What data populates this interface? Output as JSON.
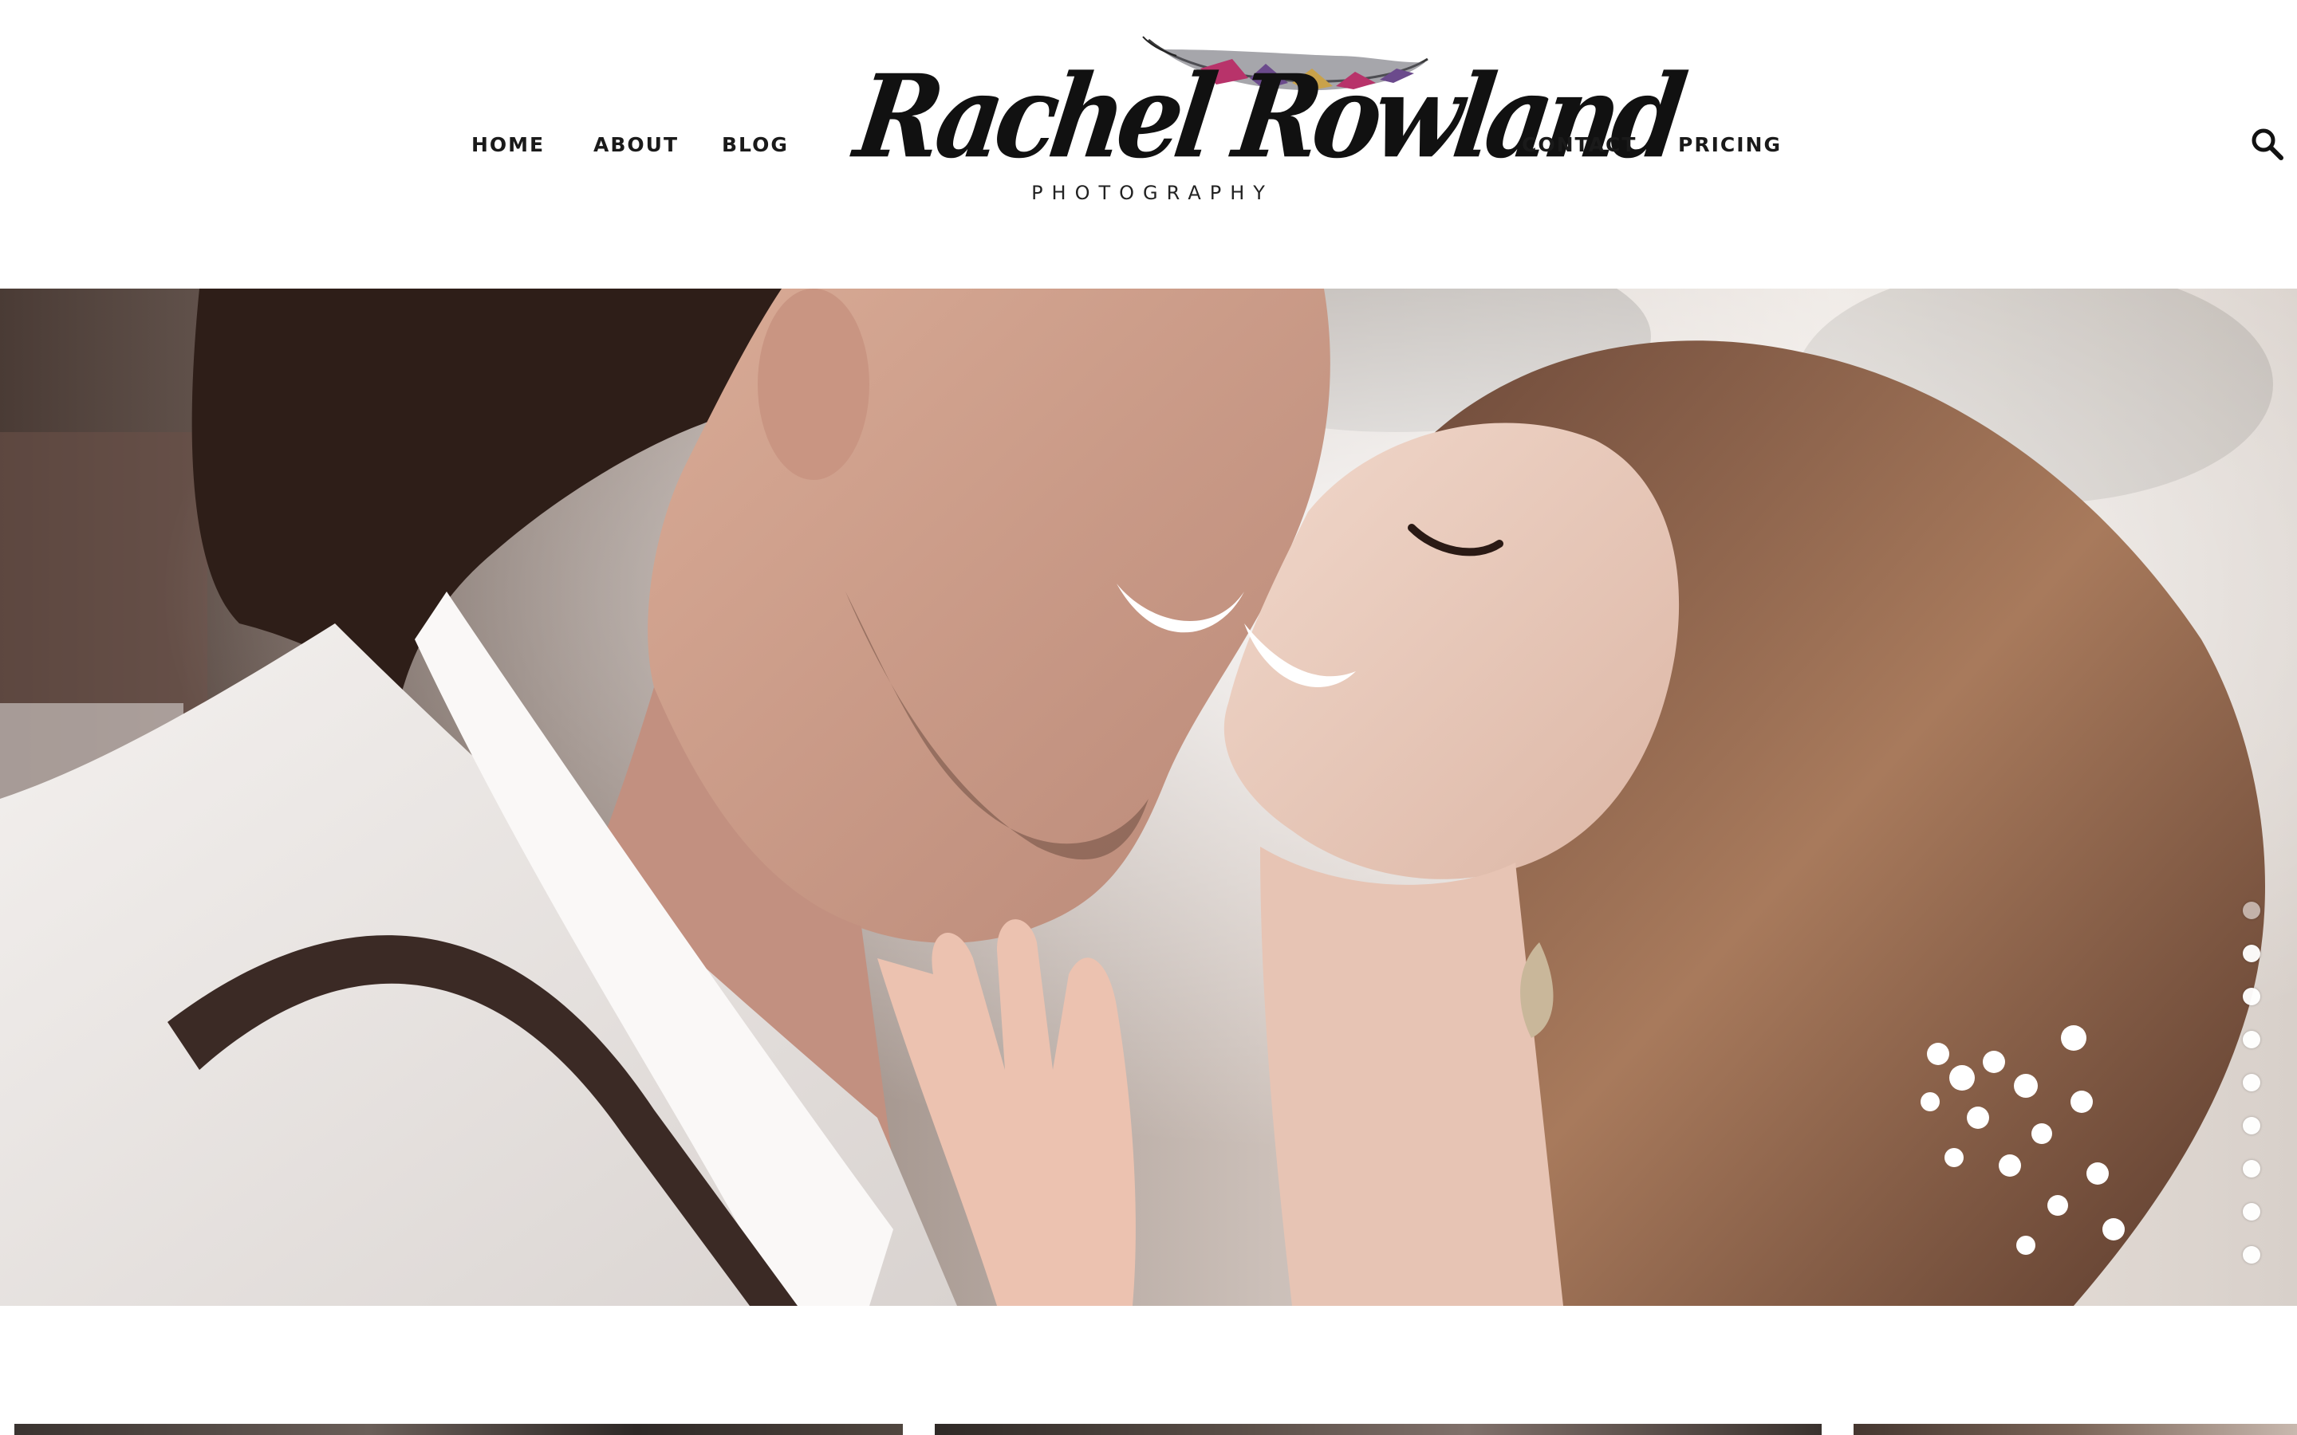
{
  "nav": {
    "left": [
      {
        "label": "HOME"
      },
      {
        "label": "ABOUT"
      },
      {
        "label": "BLOG"
      }
    ],
    "right": [
      {
        "label": "CONTACT"
      },
      {
        "label": "PRICING"
      }
    ],
    "search_icon": "search-icon"
  },
  "logo": {
    "script": "Rachel Rowland",
    "subtitle": "PHOTOGRAPHY",
    "icon": "feather-icon"
  },
  "hero": {
    "image": "couple-laughing-nose-to-nose-photo",
    "slides_total": 9,
    "active_slide": 1
  },
  "thumbnails": {
    "count": 3
  },
  "colors": {
    "text": "#1a1a1a",
    "background": "#ffffff",
    "feather_pink": "#b8336a",
    "feather_purple": "#6b4a8c",
    "feather_gold": "#c9a24a"
  }
}
